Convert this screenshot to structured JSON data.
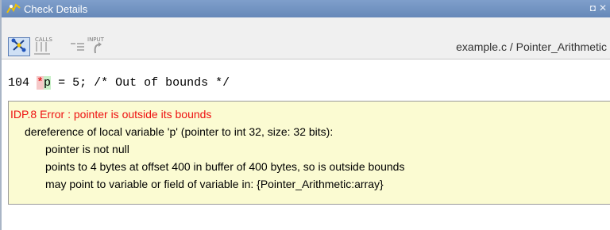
{
  "window": {
    "title": "Check Details"
  },
  "toolbar": {
    "calls_label": "CALLS",
    "input_label": "INPUT",
    "path": "example.c / Pointer_Arithmetic"
  },
  "code": {
    "line_number": "104",
    "star": "*",
    "var": "p",
    "rest": " = 5; /* Out of bounds */"
  },
  "details": {
    "header": "IDP.8 Error : pointer is outside its bounds",
    "deref": "dereference of local variable 'p' (pointer to int 32, size: 32 bits):",
    "line1": "pointer is not null",
    "line2": "points to 4 bytes at offset 400 in buffer of 400 bytes, so is outside bounds",
    "line3": "may point to variable or field of variable in: {Pointer_Arithmetic:array}"
  },
  "colors": {
    "titlebar": "#6f90bf",
    "error": "#ee1111",
    "message_bg": "#fbfbd2"
  }
}
